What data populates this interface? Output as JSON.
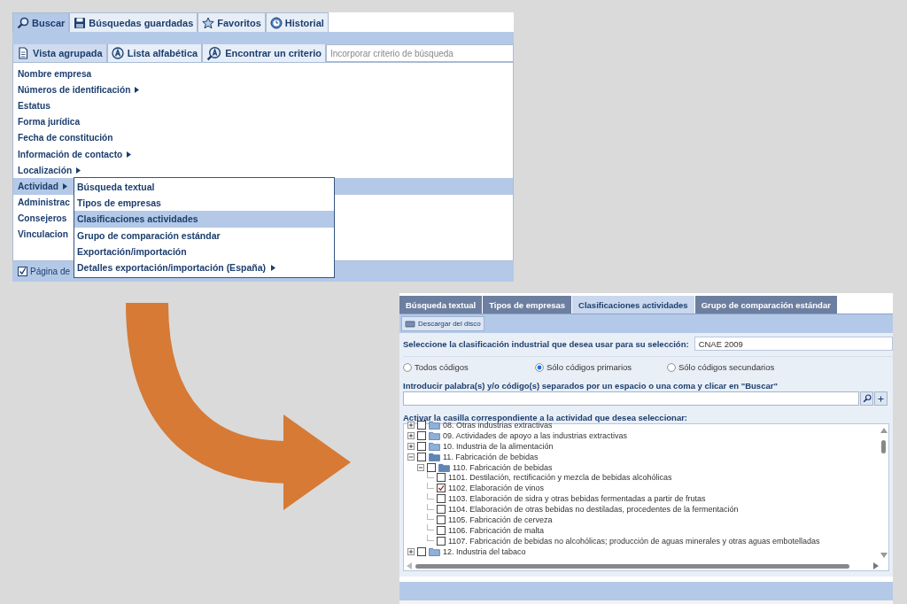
{
  "search_panel": {
    "tabs": [
      {
        "label": "Buscar",
        "selected": true
      },
      {
        "label": "Búsquedas guardadas",
        "selected": false
      },
      {
        "label": "Favoritos",
        "selected": false
      },
      {
        "label": "Historial",
        "selected": false
      }
    ],
    "view_tabs": [
      {
        "label": "Vista agrupada",
        "selected": true
      },
      {
        "label": "Lista alfabética",
        "selected": false
      },
      {
        "label": "Encontrar un criterio",
        "selected": false
      }
    ],
    "criteria_search": {
      "placeholder": "Incorporar criterio de búsqueda"
    },
    "criteria": [
      {
        "label": "Nombre empresa",
        "has_submenu": false,
        "selected": false
      },
      {
        "label": "Números de identificación",
        "has_submenu": true,
        "selected": false
      },
      {
        "label": "Estatus",
        "has_submenu": false,
        "selected": false
      },
      {
        "label": "Forma jurídica",
        "has_submenu": false,
        "selected": false
      },
      {
        "label": "Fecha de constitución",
        "has_submenu": false,
        "selected": false
      },
      {
        "label": "Información de contacto",
        "has_submenu": true,
        "selected": false
      },
      {
        "label": "Localización",
        "has_submenu": true,
        "selected": false
      },
      {
        "label": "Actividad",
        "has_submenu": true,
        "selected": true
      },
      {
        "label": "Administrac",
        "has_submenu": false,
        "selected": false
      },
      {
        "label": "Consejeros",
        "has_submenu": false,
        "selected": false
      },
      {
        "label": "Vinculacion",
        "has_submenu": false,
        "selected": false
      }
    ],
    "submenu": [
      {
        "label": "Búsqueda textual",
        "has_submenu": false,
        "selected": false
      },
      {
        "label": "Tipos de empresas",
        "has_submenu": false,
        "selected": false
      },
      {
        "label": "Clasificaciones actividades",
        "has_submenu": false,
        "selected": true
      },
      {
        "label": "Grupo de comparación estándar",
        "has_submenu": false,
        "selected": false
      },
      {
        "label": "Exportación/importación",
        "has_submenu": false,
        "selected": false
      },
      {
        "label": "Detalles exportación/importación (España)",
        "has_submenu": true,
        "selected": false
      }
    ],
    "footer_checkbox": {
      "label": "Página de",
      "checked": true
    }
  },
  "activity_panel": {
    "tabs": [
      {
        "label": "Búsqueda textual",
        "selected": false
      },
      {
        "label": "Tipos de empresas",
        "selected": false
      },
      {
        "label": "Clasificaciones actividades",
        "selected": true
      },
      {
        "label": "Grupo de comparación estándar",
        "selected": false
      }
    ],
    "toolbar_button": "Descargar del disco",
    "classification_label": "Seleccione la clasificación industrial que desea usar para su selección:",
    "classification_value": "CNAE 2009",
    "code_options": [
      {
        "label": "Todos códigos",
        "selected": false
      },
      {
        "label": "Sólo códigos primarios",
        "selected": true
      },
      {
        "label": "Sólo códigos secundarios",
        "selected": false
      }
    ],
    "keyword_label": "Introducir palabra(s) y/o código(s) separados por un espacio o una coma y clicar en \"Buscar\"",
    "tree_label": "Activar la casilla correspondiente a la actividad que desea seleccionar:",
    "tree": [
      {
        "kind": "folder",
        "label": "08. Otras industrias extractivas",
        "expanded": false,
        "checked": false
      },
      {
        "kind": "folder",
        "label": "09. Actividades de apoyo a las industrias extractivas",
        "expanded": false,
        "checked": false
      },
      {
        "kind": "folder",
        "label": "10. Industria de la alimentación",
        "expanded": false,
        "checked": false
      },
      {
        "kind": "folder",
        "label": "11. Fabricación de bebidas",
        "expanded": true,
        "checked": false,
        "children": [
          {
            "kind": "folder",
            "label": "110. Fabricación de bebidas",
            "expanded": true,
            "checked": false,
            "children": [
              {
                "kind": "item",
                "label": "1101. Destilación, rectificación y mezcla de bebidas alcohólicas",
                "checked": false
              },
              {
                "kind": "item",
                "label": "1102. Elaboración de vinos",
                "checked": true
              },
              {
                "kind": "item",
                "label": "1103. Elaboración de sidra y otras bebidas fermentadas a partir de frutas",
                "checked": false
              },
              {
                "kind": "item",
                "label": "1104. Elaboración de otras bebidas no destiladas, procedentes de la fermentación",
                "checked": false
              },
              {
                "kind": "item",
                "label": "1105. Fabricación de cerveza",
                "checked": false
              },
              {
                "kind": "item",
                "label": "1106. Fabricación de malta",
                "checked": false
              },
              {
                "kind": "item",
                "label": "1107. Fabricación de bebidas no alcohólicas; producción de aguas minerales y otras aguas embotelladas",
                "checked": false
              }
            ]
          }
        ]
      },
      {
        "kind": "folder",
        "label": "12. Industria del tabaco",
        "expanded": false,
        "checked": false
      }
    ]
  }
}
